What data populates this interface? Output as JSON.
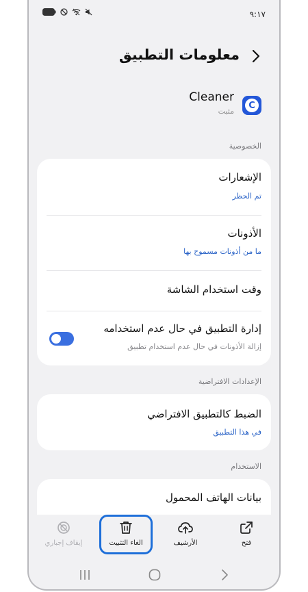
{
  "status_bar": {
    "time": "٩:١٧"
  },
  "header": {
    "title": "معلومات التطبيق"
  },
  "app": {
    "name": "Cleaner",
    "status": "مثبت",
    "icon_letter": "C"
  },
  "sections": {
    "privacy": "الخصوصية",
    "defaults": "الإعدادات الافتراضية",
    "usage": "الاستخدام"
  },
  "privacy_items": {
    "notifications": {
      "title": "الإشعارات",
      "subtitle": "تم الحظر"
    },
    "permissions": {
      "title": "الأذونات",
      "subtitle": "ما من أذونات مسموح بها"
    },
    "screen_time": {
      "title": "وقت استخدام الشاشة"
    },
    "manage_unused": {
      "title": "إدارة التطبيق في حال عدم استخدامه",
      "subtitle": "إزالة الأذونات في حال عدم استخدام تطبيق",
      "toggle_on": true
    }
  },
  "default_items": {
    "set_default": {
      "title": "الضبط كالتطبيق الافتراضي",
      "subtitle": "في هذا التطبيق"
    }
  },
  "usage_items": {
    "mobile_data": {
      "title": "بيانات الهاتف المحمول"
    }
  },
  "actions": {
    "open": "فتح",
    "archive": "الأرشيف",
    "uninstall": "الغاء التثبيت",
    "force_stop": "إيقاف إجباري"
  },
  "colors": {
    "accent": "#1e6fd9",
    "link": "#2a63c7",
    "app_icon": "#2357d8"
  }
}
